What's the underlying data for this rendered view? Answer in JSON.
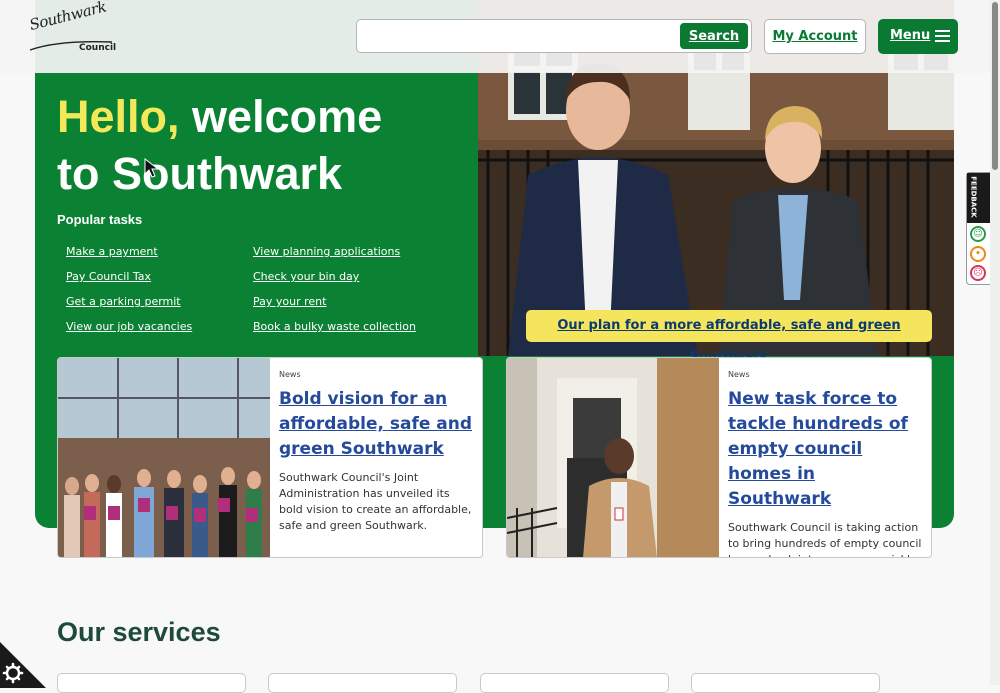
{
  "header": {
    "logo_script": "Southwark",
    "logo_council": "Council",
    "search_placeholder": "",
    "search_label": "Search",
    "account_label": "My Account",
    "menu_label": "Menu"
  },
  "hero": {
    "hello": "Hello,",
    "welcome_line1": " welcome",
    "welcome_line2": "to Southwark",
    "popular_heading": "Popular tasks",
    "tasks": [
      "Make a payment",
      "View planning applications",
      "Pay Council Tax",
      "Check your bin day",
      "Get a parking permit",
      "Pay your rent",
      "View our job vacancies",
      "Book a bulky waste collection"
    ],
    "plan_link": "Our plan for a more affordable, safe and green Southwark"
  },
  "cards": [
    {
      "tag": "News",
      "title": "Bold vision for an affordable, safe and green Southwark",
      "text": "Southwark Council's Joint Administration has unveiled its bold vision to create an affordable, safe and green Southwark."
    },
    {
      "tag": "News",
      "title": "New task force to tackle hundreds of empty council homes in Southwark",
      "text": "Southwark Council is taking action to bring hundreds of empty council homes back into use more quickly."
    }
  ],
  "services": {
    "heading": "Our services"
  },
  "feedback": {
    "label": "FEEDBACK"
  },
  "colors": {
    "brand_green": "#0b8233",
    "accent_yellow": "#f2e85a",
    "link_blue": "#254a9b"
  }
}
